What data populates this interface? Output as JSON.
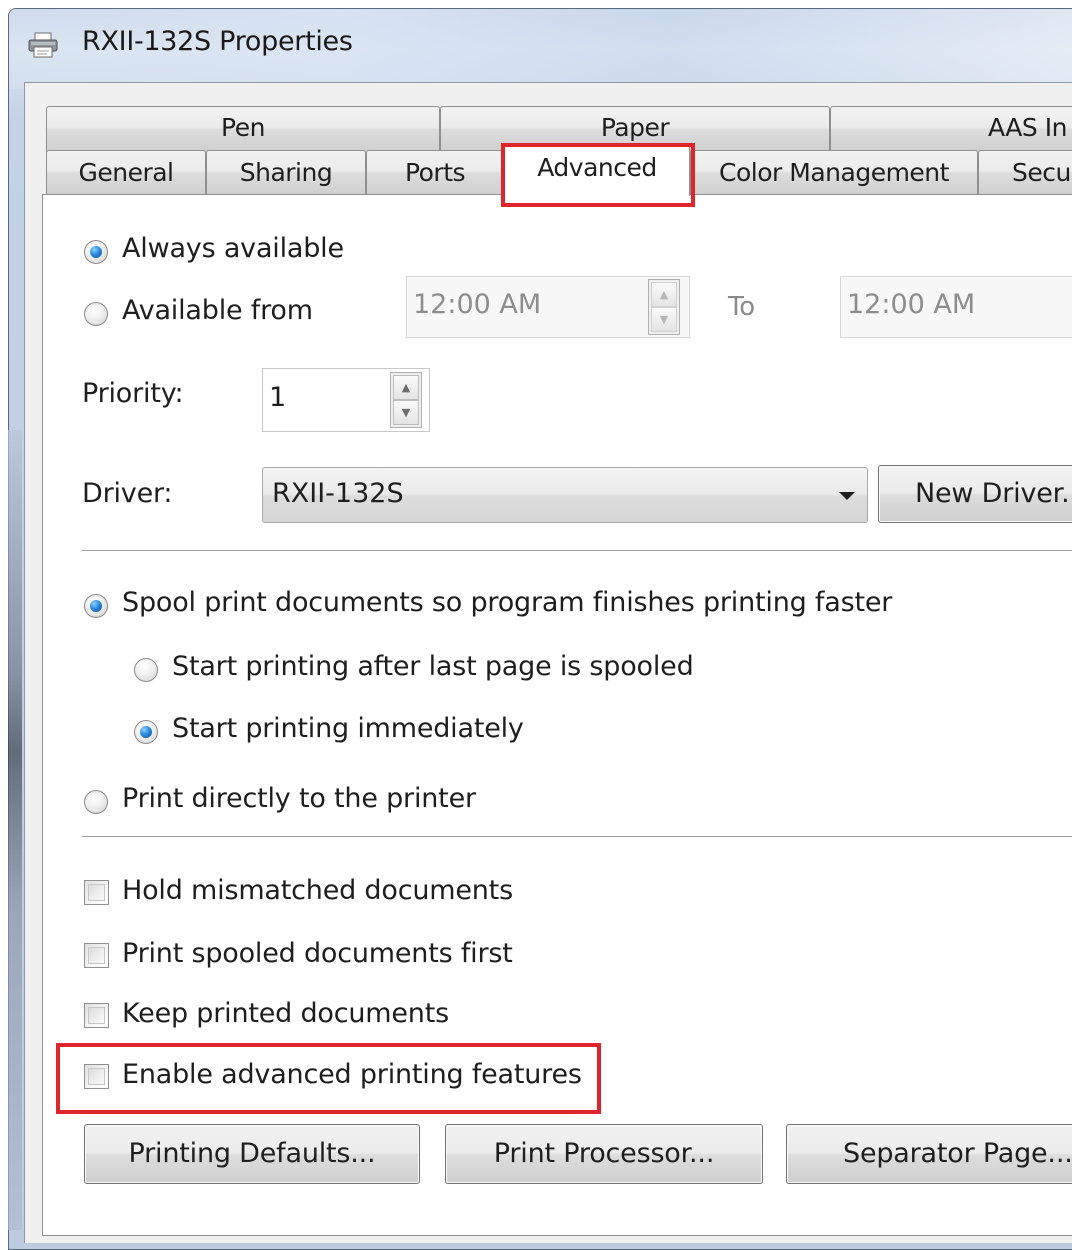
{
  "window": {
    "title": "RXII-132S Properties"
  },
  "tabs": {
    "row_back": [
      {
        "label": "Pen"
      },
      {
        "label": "Paper"
      },
      {
        "label": "AAS In"
      }
    ],
    "row_front": [
      {
        "label": "General"
      },
      {
        "label": "Sharing"
      },
      {
        "label": "Ports"
      },
      {
        "label": "Advanced"
      },
      {
        "label": "Color Management"
      },
      {
        "label": "Secu"
      }
    ],
    "active": "Advanced"
  },
  "availability": {
    "always_label": "Always available",
    "always_selected": true,
    "from_label": "Available from",
    "from_time": "12:00 AM",
    "to_label": "To",
    "to_time": "12:00 AM"
  },
  "priority": {
    "label": "Priority:",
    "value": "1"
  },
  "driver": {
    "label": "Driver:",
    "value": "RXII-132S",
    "new_driver_button": "New Driver."
  },
  "spooling": {
    "spool_label": "Spool print documents so program finishes printing faster",
    "spool_selected": true,
    "after_last_page_label": "Start printing after last page is spooled",
    "after_last_page_selected": false,
    "immediately_label": "Start printing immediately",
    "immediately_selected": true,
    "direct_label": "Print directly to the printer",
    "direct_selected": false
  },
  "options": {
    "hold_mismatched": {
      "label": "Hold mismatched documents",
      "checked": false
    },
    "spooled_first": {
      "label": "Print spooled documents first",
      "checked": false
    },
    "keep_printed": {
      "label": "Keep printed documents",
      "checked": false
    },
    "advanced_features": {
      "label": "Enable advanced printing features",
      "checked": false
    }
  },
  "buttons": {
    "printing_defaults": "Printing Defaults...",
    "print_processor": "Print Processor...",
    "separator_page": "Separator Page..."
  },
  "annotations": {
    "highlight_color": "#e0242c"
  }
}
